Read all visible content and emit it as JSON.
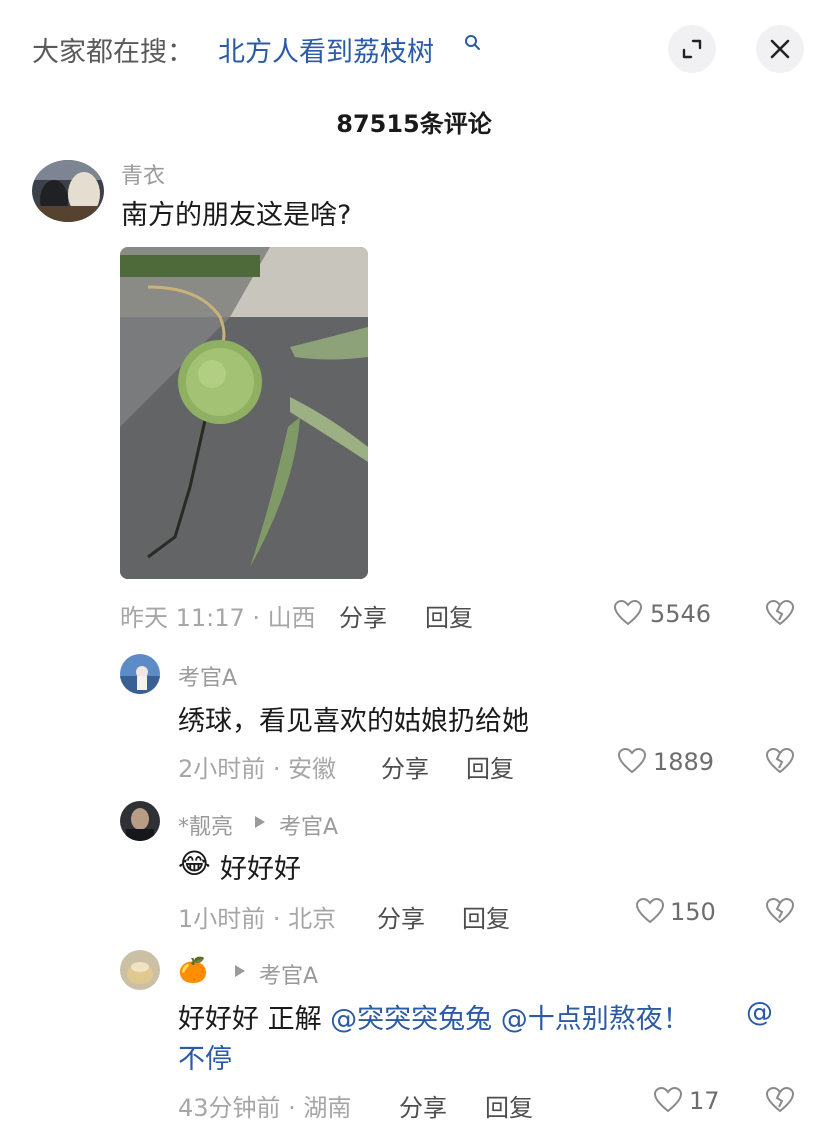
{
  "header": {
    "search_prefix": "大家都在搜：",
    "search_term": "北方人看到荔枝树",
    "expand_icon": "expand-icon",
    "close_icon": "close-icon"
  },
  "comment_count_label": "87515条评论",
  "main_comment": {
    "username": "青衣",
    "text": "南方的朋友这是啥?",
    "image_desc_icon": "chestnut-burr-photo",
    "meta": "昨天 11:17 · 山西",
    "share": "分享",
    "reply": "回复",
    "likes": "5546"
  },
  "replies": [
    {
      "username": "考官A",
      "text": "绣球，看见喜欢的姑娘扔给她",
      "meta": "2小时前 · 安徽",
      "share": "分享",
      "reply": "回复",
      "likes": "1889"
    },
    {
      "username": "*靓亮",
      "reply_to": "考官A",
      "emoji": "😂",
      "text": "好好好",
      "meta": "1小时前 · 北京",
      "share": "分享",
      "reply": "回复",
      "likes": "150"
    },
    {
      "username": "🍊",
      "reply_to": "考官A",
      "text_prefix": "好好好 正解 ",
      "mention1": "@突突突兔兔",
      "mention2": "@十点别熬夜！",
      "mention3_line1": "@",
      "mention3_line2": "不停",
      "meta": "43分钟前 · 湖南",
      "share": "分享",
      "reply": "回复",
      "likes": "17"
    }
  ],
  "colors": {
    "link": "#2b5aa6",
    "meta": "#a6a6a6",
    "text": "#1a1a1a"
  }
}
